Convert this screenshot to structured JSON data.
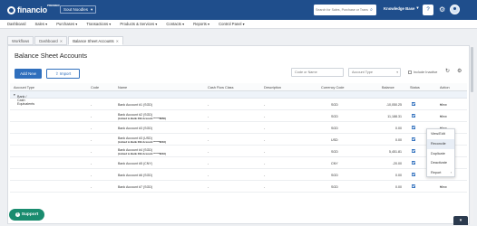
{
  "topbar": {
    "logo_text": "financio",
    "logo_tag": "PREMIER",
    "company": "Sout Noodles",
    "search_placeholder": "Search for Sales, Purchase or Transactions",
    "knowledge_base": "Knowledge Base",
    "help_icon": "question-icon",
    "settings_icon": "gear-icon"
  },
  "nav": [
    "Dashboard",
    "Sales",
    "Purchases",
    "Transactions",
    "Products & Services",
    "Contacts",
    "Reports",
    "Control Panel"
  ],
  "tabs": [
    {
      "label": "Workflows",
      "closable": false,
      "active": false
    },
    {
      "label": "Dashboard",
      "closable": true,
      "active": false
    },
    {
      "label": "Balance Sheet Accounts",
      "closable": true,
      "active": true
    }
  ],
  "page": {
    "title": "Balance Sheet Accounts",
    "add_new": "Add New",
    "import": "Import",
    "filter_code_placeholder": "Code or Name",
    "filter_type_placeholder": "Account Type",
    "include_inactive": "Include Inactive"
  },
  "table": {
    "columns": [
      "Account Type",
      "Code",
      "Name",
      "Cash Flow Class",
      "Description",
      "Currency Code",
      "Balance",
      "Status",
      "Action"
    ],
    "group": "Bank / Cash Equivalents",
    "rows": [
      {
        "code": "-",
        "name": "Bank Account #1 (SGD)",
        "sub": "",
        "cash_flow": "-",
        "description": "-",
        "currency": "SGD",
        "balance": "-10,050.25",
        "action": "View"
      },
      {
        "code": "-",
        "name": "Bank Account #2 (SGD)",
        "sub": "(Linked to Bank ICB Account ******8856)",
        "cash_flow": "-",
        "description": "-",
        "currency": "SGD",
        "balance": "11,188.31",
        "action": "View"
      },
      {
        "code": "-",
        "name": "Bank Account #3 (SGD)",
        "sub": "",
        "cash_flow": "-",
        "description": "-",
        "currency": "SGD",
        "balance": "0.00",
        "action": "View"
      },
      {
        "code": "-",
        "name": "Bank Account #3 (USD)",
        "sub": "(Linked to Bank ICB Account ******8216)",
        "cash_flow": "-",
        "description": "-",
        "currency": "USD",
        "balance": "0.00",
        "action": "View"
      },
      {
        "code": "-",
        "name": "Bank Account #4 (SGD)",
        "sub": "(Linked to Bank ICB Account ******8216)",
        "cash_flow": "-",
        "description": "-",
        "currency": "SGD",
        "balance": "5,451.81",
        "action": "View"
      },
      {
        "code": "-",
        "name": "Bank Account #5 (CNY)",
        "sub": "",
        "cash_flow": "-",
        "description": "-",
        "currency": "CNY",
        "balance": "-20.00",
        "action": "View"
      },
      {
        "code": "-",
        "name": "Bank Account #6 (SGD)",
        "sub": "",
        "cash_flow": "-",
        "description": "-",
        "currency": "SGD",
        "balance": "0.00",
        "action": "View"
      },
      {
        "code": "-",
        "name": "Bank Account #7 (SGD)",
        "sub": "",
        "cash_flow": "-",
        "description": "-",
        "currency": "SGD",
        "balance": "0.00",
        "action": "View"
      }
    ]
  },
  "menu": {
    "items": [
      "View/Edit",
      "Reconcile",
      "Duplicate",
      "Deactivate",
      "Report"
    ],
    "highlighted": "Reconcile"
  },
  "support": "Support"
}
